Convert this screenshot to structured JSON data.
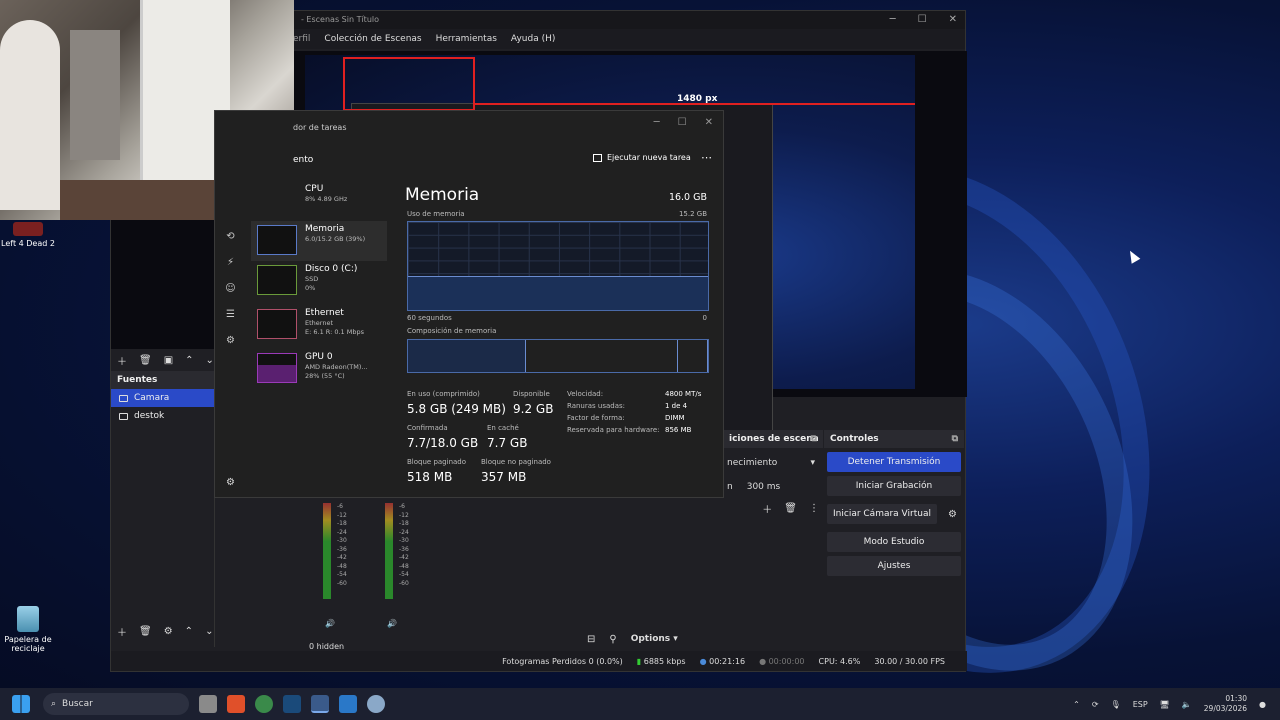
{
  "desktop": {
    "icons": [
      {
        "label": "Left 4 Dead 2",
        "icon": "l4d2-icon"
      },
      {
        "label": "Papelera de reciclaje",
        "icon": "recycle-bin-icon"
      }
    ]
  },
  "obs": {
    "title": "- Escenas Sin Título",
    "menu": [
      "Colección de Escenas",
      "Herramientas",
      "Ayuda (H)"
    ],
    "menu_cut": "erfil",
    "preview_px_label": "1480 px",
    "sources_title": "Fuentes",
    "sources": [
      {
        "label": "Camara",
        "selected": true
      },
      {
        "label": "destok",
        "selected": false
      }
    ],
    "transitions_title": "iciones de escena",
    "transition_type": "necimiento",
    "duration_label": "n",
    "duration": "300 ms",
    "controls_title": "Controles",
    "controls": [
      "Detener Transmisión",
      "Iniciar Grabación",
      "Iniciar Cámara Virtual",
      "Modo Estudio",
      "Ajustes"
    ],
    "mixer_hidden": "0 hidden",
    "mixer_options": "Options",
    "meter_scale": [
      "-6",
      "-12",
      "-18",
      "-24",
      "-30",
      "-36",
      "-42",
      "-48",
      "-54",
      "-60"
    ],
    "status": {
      "dropped": "Fotogramas Perdidos 0 (0.0%)",
      "bitrate": "6885 kbps",
      "stream_time": "00:21:16",
      "rec_time": "00:00:00",
      "cpu": "CPU: 4.6%",
      "fps": "30.00 / 30.00 FPS"
    }
  },
  "taskmgr": {
    "title": "dor de tareas",
    "heading": "ento",
    "new_task": "Ejecutar nueva tarea",
    "items": [
      {
        "name": "CPU",
        "sub1": "8% 4.89 GHz",
        "sub2": "",
        "sub3": "",
        "color": "#4a8ad8"
      },
      {
        "name": "Memoria",
        "sub1": "6.0/15.2 GB (39%)",
        "sub2": "",
        "sub3": "",
        "color": "#5a7ac8"
      },
      {
        "name": "Disco 0 (C:)",
        "sub1": "SSD",
        "sub2": "0%",
        "sub3": "",
        "color": "#6a9a3a"
      },
      {
        "name": "Ethernet",
        "sub1": "Ethernet",
        "sub2": "E: 6.1  R: 0.1 Mbps",
        "sub3": "",
        "color": "#b0506a"
      },
      {
        "name": "GPU 0",
        "sub1": "AMD Radeon(TM)...",
        "sub2": "28% (55 °C)",
        "sub3": "",
        "color": "#9a3ab8"
      }
    ],
    "memory": {
      "title": "Memoria",
      "total": "16.0 GB",
      "usage_label": "Uso de memoria",
      "usage_max": "15.2 GB",
      "time_label": "60 segundos",
      "zero": "0",
      "composition_label": "Composición de memoria",
      "usage_level": 0.39,
      "stats": [
        {
          "key": "En uso (comprimido)",
          "value": "5.8 GB (249 MB)"
        },
        {
          "key": "Disponible",
          "value": "9.2 GB"
        },
        {
          "key": "Confirmada",
          "value": "7.7/18.0 GB"
        },
        {
          "key": "En caché",
          "value": "7.7 GB"
        },
        {
          "key": "Bloque paginado",
          "value": "518 MB"
        },
        {
          "key": "Bloque no paginado",
          "value": "357 MB"
        }
      ],
      "details": [
        {
          "key": "Velocidad:",
          "value": "4800 MT/s"
        },
        {
          "key": "Ranuras usadas:",
          "value": "1 de 4"
        },
        {
          "key": "Factor de forma:",
          "value": "DIMM"
        },
        {
          "key": "Reservada para hardware:",
          "value": "856 MB"
        }
      ]
    }
  },
  "taskbar": {
    "search_placeholder": "Buscar",
    "lang": "ESP",
    "time": "01:30",
    "date": "29/03/2026"
  }
}
